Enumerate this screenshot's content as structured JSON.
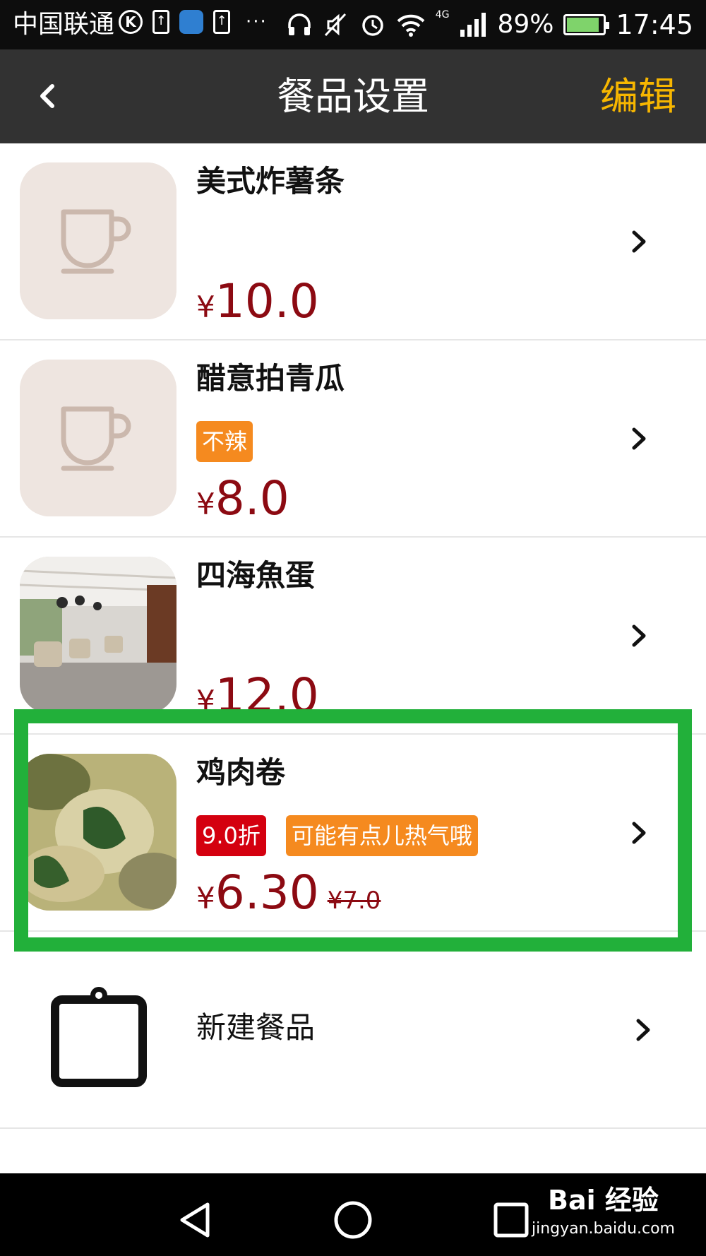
{
  "status_bar": {
    "carrier": "中国联通",
    "battery_percent": "89%",
    "time": "17:45",
    "network": "4G",
    "battery_level": 0.89,
    "icons_left": [
      "k-circle-icon",
      "upload-icon",
      "app-icon",
      "upload-icon",
      "more-dots-icon"
    ],
    "icons_right": [
      "headphones-icon",
      "mute-icon",
      "alarm-icon",
      "wifi-icon",
      "signal-icon",
      "battery-icon"
    ]
  },
  "header": {
    "title": "餐品设置",
    "edit_label": "编辑",
    "back_icon": "chevron-left-icon"
  },
  "items": [
    {
      "name": "美式炸薯条",
      "tags": [],
      "currency": "¥",
      "price": "10.0",
      "original_price": "",
      "image": "cup-placeholder-icon"
    },
    {
      "name": "醋意拍青瓜",
      "tags": [
        {
          "label": "不辣",
          "color": "#f58a1f"
        }
      ],
      "currency": "¥",
      "price": "8.0",
      "original_price": "",
      "image": "cup-placeholder-icon"
    },
    {
      "name": "四海魚蛋",
      "tags": [],
      "currency": "¥",
      "price": "12.0",
      "original_price": "",
      "image": "restaurant-photo"
    },
    {
      "name": "鸡肉卷",
      "tags": [
        {
          "label": "9.0折",
          "color": "#d4000f"
        },
        {
          "label": "可能有点儿热气哦",
          "color": "#f58a1f"
        }
      ],
      "currency": "¥",
      "price": "6.30",
      "original_price": "¥7.0",
      "image": "food-photo"
    }
  ],
  "new_item": {
    "label": "新建餐品",
    "icon": "clipboard-icon"
  },
  "nav_bar": {
    "buttons": [
      "back-triangle-icon",
      "home-circle-icon",
      "recents-square-icon"
    ]
  },
  "watermark": {
    "main": "Bai  经验",
    "sub": "jingyan.baidu.com"
  },
  "colors": {
    "header_bg": "#323232",
    "accent": "#f7b600",
    "price": "#8c0a12",
    "tag_orange": "#f58a1f",
    "tag_red": "#d4000f",
    "highlight": "#22b03a"
  }
}
